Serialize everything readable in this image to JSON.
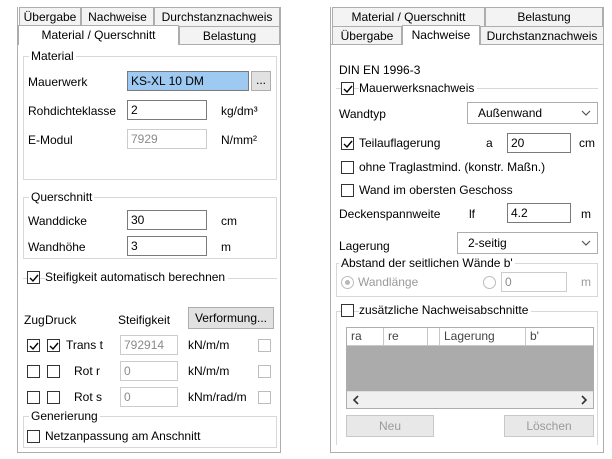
{
  "left": {
    "tabs_row1": [
      "Übergabe",
      "Nachweise",
      "Durchstanznachweis"
    ],
    "tabs_row2": [
      "Material / Querschnitt",
      "Belastung"
    ],
    "material": {
      "legend": "Material",
      "mauerwerk_label": "Mauerwerk",
      "mauerwerk_value": "KS-XL 10 DM",
      "browse_label": "...",
      "rohdichte_label": "Rohdichteklasse",
      "rohdichte_value": "2",
      "rohdichte_unit": "kg/dm³",
      "emodul_label": "E-Modul",
      "emodul_value": "7929",
      "emodul_unit": "N/mm²"
    },
    "querschnitt": {
      "legend": "Querschnitt",
      "wanddicke_label": "Wanddicke",
      "wanddicke_value": "30",
      "wanddicke_unit": "cm",
      "wandhoehe_label": "Wandhöhe",
      "wandhoehe_value": "3",
      "wandhoehe_unit": "m"
    },
    "steifigkeit": {
      "auto_label": "Steifigkeit automatisch berechnen",
      "header_zug": "Zug",
      "header_druck": "Druck",
      "header_steifigkeit": "Steifigkeit",
      "verformung_button": "Verformung...",
      "rows": [
        {
          "label": "Trans t",
          "value": "792914",
          "unit": "kN/m/m"
        },
        {
          "label": "Rot r",
          "value": "0",
          "unit": "kN/m/m"
        },
        {
          "label": "Rot s",
          "value": "0",
          "unit": "kNm/rad/m"
        }
      ]
    },
    "generierung": {
      "legend": "Generierung",
      "netz_label": "Netzanpassung am Anschnitt"
    }
  },
  "right": {
    "tabs_row1": [
      "Material / Querschnitt",
      "Belastung"
    ],
    "tabs_row2": [
      "Übergabe",
      "Nachweise",
      "Durchstanznachweis"
    ],
    "norm": "DIN EN 1996-3",
    "mauerwerksnachweis_label": "Mauerwerksnachweis",
    "wandtyp_label": "Wandtyp",
    "wandtyp_value": "Außenwand",
    "teilauflagerung_label": "Teilauflagerung",
    "a_label": "a",
    "a_value": "20",
    "a_unit": "cm",
    "ohne_label": "ohne Traglastmind. (konstr. Maßn.)",
    "oberste_label": "Wand im obersten Geschoss",
    "decken_label": "Deckenspannweite",
    "lf_label": "lf",
    "decken_value": "4.2",
    "decken_unit": "m",
    "lagerung_label": "Lagerung",
    "lagerung_value": "2-seitig",
    "abstand_legend": "Abstand der seitlichen Wände b'",
    "wandlaenge_label": "Wandlänge",
    "abstand_value": "0",
    "abstand_unit": "m",
    "zusaetzlich_label": "zusätzliche Nachweisabschnitte",
    "grid_headers": [
      "ra",
      "re",
      "Lagerung",
      "b'"
    ],
    "neu_button": "Neu",
    "loeschen_button": "Löschen"
  }
}
